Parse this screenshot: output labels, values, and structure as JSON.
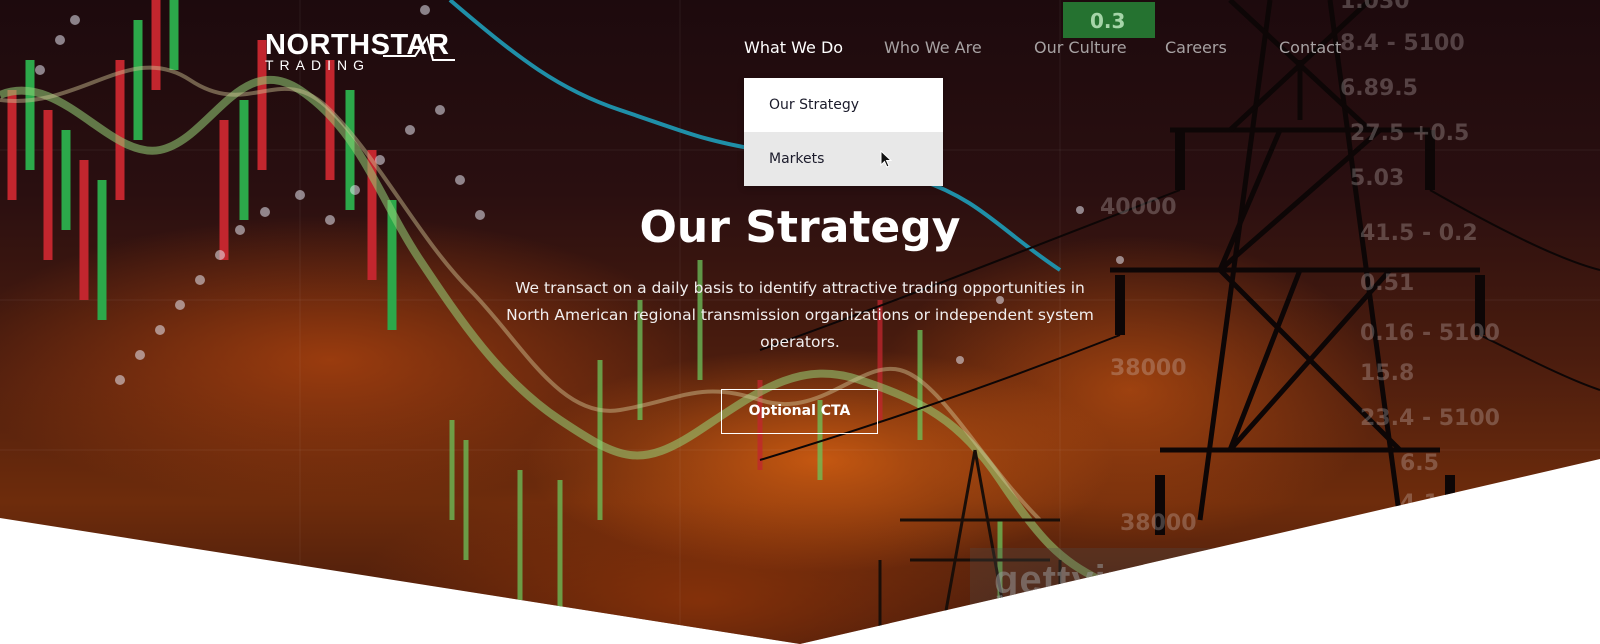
{
  "brand": {
    "line1": "NORTHSTAR",
    "line2": "TRADING"
  },
  "nav": {
    "items": [
      {
        "label": "What We Do",
        "active": true
      },
      {
        "label": "Who We Are",
        "active": false
      },
      {
        "label": "Our Culture",
        "active": false
      },
      {
        "label": "Careers",
        "active": false
      },
      {
        "label": "Contact",
        "active": false
      }
    ]
  },
  "dropdown": {
    "items": [
      {
        "label": "Our Strategy"
      },
      {
        "label": "Markets",
        "hovered": true
      }
    ]
  },
  "hero": {
    "title": "Our Strategy",
    "description": "We transact on a daily basis to identify attractive trading opportunities in North American regional transmission organizations or independent system operators.",
    "cta_label": "Optional CTA"
  },
  "watermark": {
    "text": "gettyimages"
  },
  "icons": {
    "cursor": "mouse-pointer-icon"
  },
  "colors": {
    "nav_active": "#ffffff",
    "nav_inactive": "#a7a2a3",
    "dropdown_bg": "#ffffff",
    "dropdown_hover": "#e8e8e8"
  }
}
